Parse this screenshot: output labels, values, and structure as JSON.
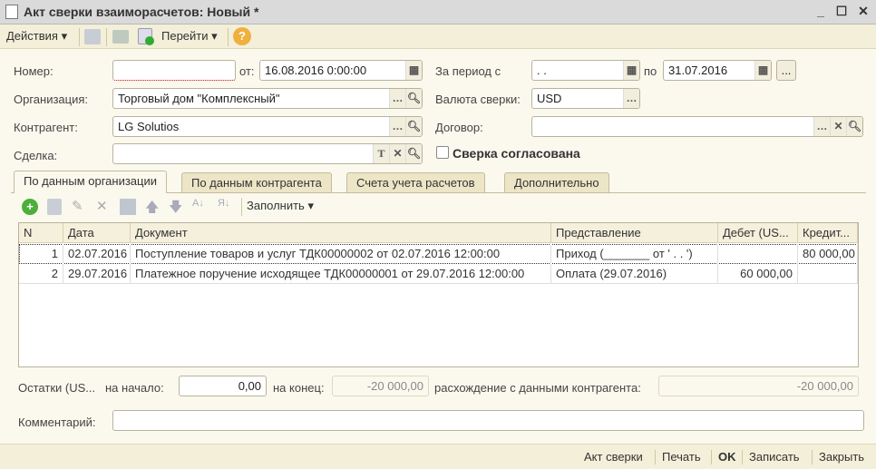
{
  "window": {
    "title": "Акт сверки взаиморасчетов: Новый *"
  },
  "toolbar": {
    "actions": "Действия",
    "goto": "Перейти",
    "help": "?"
  },
  "form": {
    "number_label": "Номер:",
    "number_value": "",
    "from_label": "от:",
    "date_value": "16.08.2016  0:00:00",
    "period_label": "За период с",
    "period_from": " .  .",
    "period_to_label": "по",
    "period_to": "31.07.2016",
    "org_label": "Организация:",
    "org_value": "Торговый дом \"Комплексный\"",
    "currency_label": "Валюта сверки:",
    "currency_value": "USD",
    "contractor_label": "Контрагент:",
    "contractor_value": "LG Solutios",
    "contract_label": "Договор:",
    "contract_value": "",
    "deal_label": "Сделка:",
    "deal_value": "",
    "agreed_label": "Сверка согласована",
    "agreed": false
  },
  "tabs": [
    "По данным организации",
    "По данным контрагента",
    "Счета учета расчетов",
    "Дополнительно"
  ],
  "table_toolbar": {
    "fill": "Заполнить"
  },
  "table": {
    "columns": [
      "N",
      "Дата",
      "Документ",
      "Представление",
      "Дебет (US...",
      "Кредит..."
    ],
    "rows": [
      [
        "1",
        "02.07.2016",
        "Поступление товаров и услуг ТДК00000002 от 02.07.2016 12:00:00",
        "Приход (_______ от ' .  .  ')",
        "",
        "80 000,00"
      ],
      [
        "2",
        "29.07.2016",
        "Платежное поручение исходящее ТДК00000001 от 29.07.2016 12:00:00",
        "Оплата (29.07.2016)",
        "60 000,00",
        ""
      ]
    ]
  },
  "balances": {
    "label": "Остатки (US...",
    "start_label": "на начало:",
    "start_value": "0,00",
    "end_label": "на конец:",
    "end_value": "-20 000,00",
    "diff_label": "расхождение с данными контрагента:",
    "diff_value": "-20 000,00"
  },
  "comment": {
    "label": "Комментарий:",
    "value": ""
  },
  "bottom": [
    "Акт сверки",
    "Печать",
    "OK",
    "Записать",
    "Закрыть"
  ]
}
